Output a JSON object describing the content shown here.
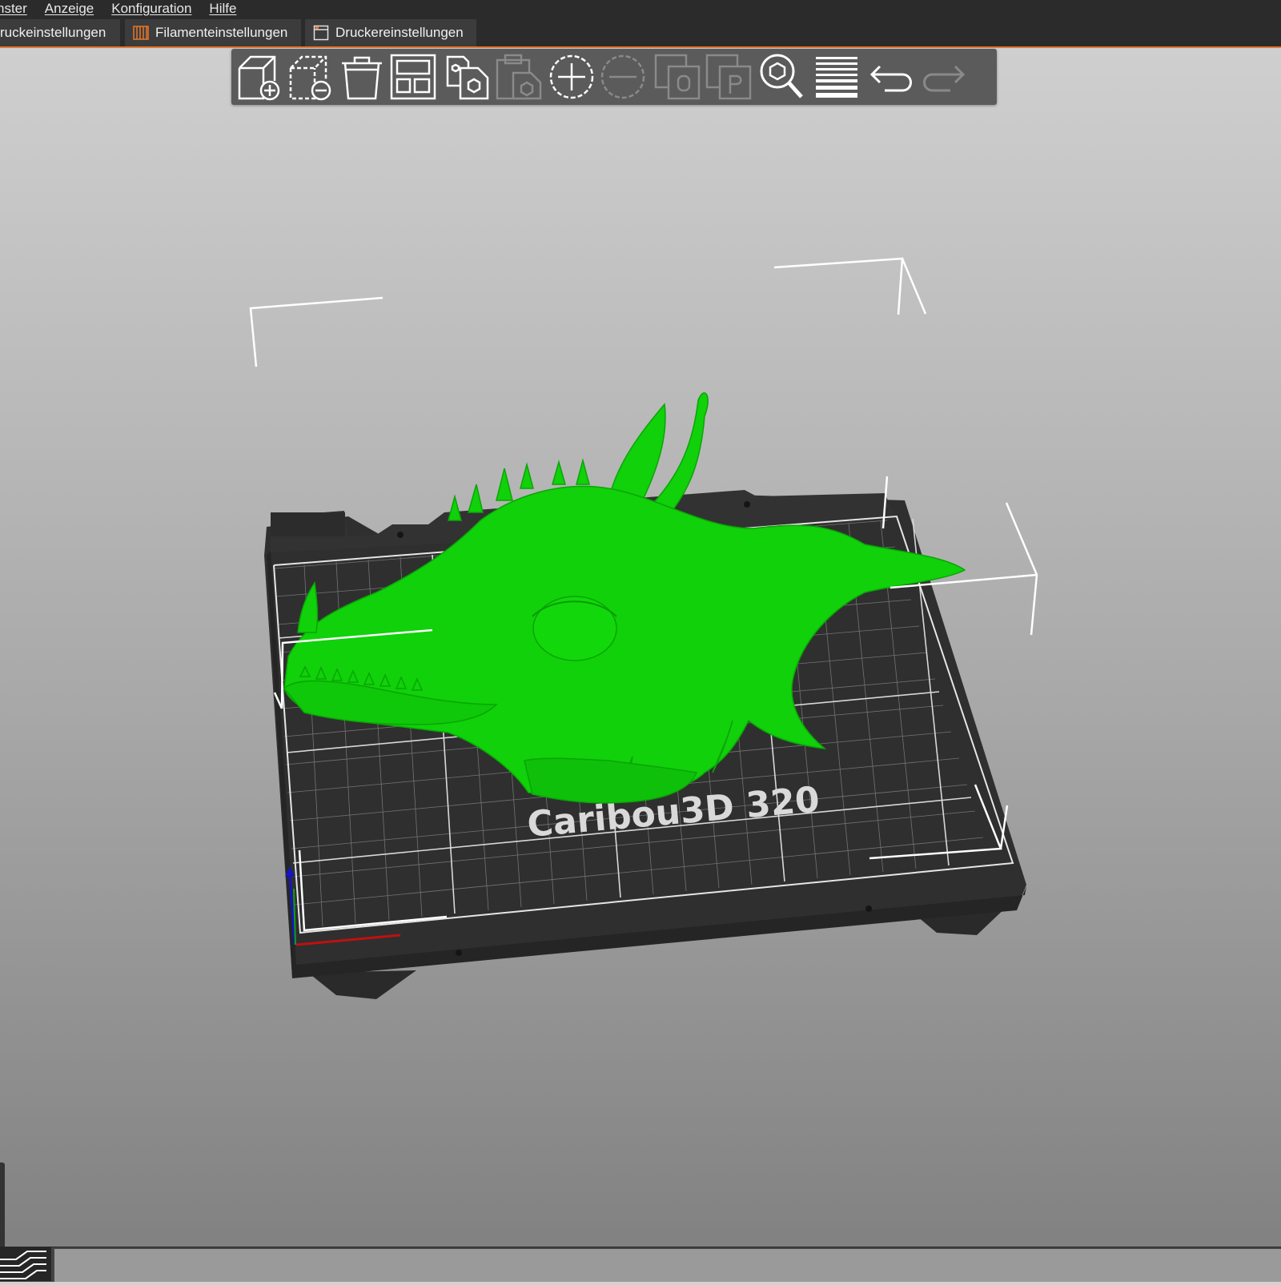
{
  "menu": {
    "items": [
      "nster",
      "Anzeige",
      "Konfiguration",
      "Hilfe"
    ]
  },
  "tabs": [
    {
      "label": "Druckeinstellungen",
      "visible_label": "ruckeinstellungen"
    },
    {
      "label": "Filamenteinstellungen",
      "icon": "filament-icon"
    },
    {
      "label": "Druckereinstellungen",
      "icon": "printer-icon"
    }
  ],
  "toolbar": {
    "buttons": [
      {
        "name": "add-object",
        "icon": "add-cube-icon",
        "enabled": true
      },
      {
        "name": "remove-object",
        "icon": "remove-cube-icon",
        "enabled": true
      },
      {
        "name": "delete-all",
        "icon": "trash-icon",
        "enabled": true
      },
      {
        "name": "arrange",
        "icon": "arrange-icon",
        "enabled": true
      },
      {
        "name": "copy",
        "icon": "copy-icon",
        "enabled": true
      },
      {
        "name": "paste",
        "icon": "paste-icon",
        "enabled": false
      },
      {
        "name": "add-instance",
        "icon": "plus-circle-icon",
        "enabled": true
      },
      {
        "name": "remove-instance",
        "icon": "minus-circle-icon",
        "enabled": false
      },
      {
        "name": "split-objects",
        "icon": "split-objects-icon",
        "enabled": false
      },
      {
        "name": "split-parts",
        "icon": "split-parts-icon",
        "enabled": false
      },
      {
        "name": "search",
        "icon": "search-icon",
        "enabled": true
      },
      {
        "name": "variable-layer-height",
        "icon": "layers-icon",
        "enabled": true
      },
      {
        "name": "undo",
        "icon": "undo-icon",
        "enabled": true
      },
      {
        "name": "redo",
        "icon": "redo-icon",
        "enabled": false
      }
    ]
  },
  "scene": {
    "bed_label": "Caribou3D 320",
    "model_color": "#10d10a",
    "bed_color": "#2e2e2e"
  },
  "colors": {
    "accent": "#e7762a",
    "menubar_bg": "#2b2b2b",
    "toolbar_bg": "#5b5b5b"
  }
}
